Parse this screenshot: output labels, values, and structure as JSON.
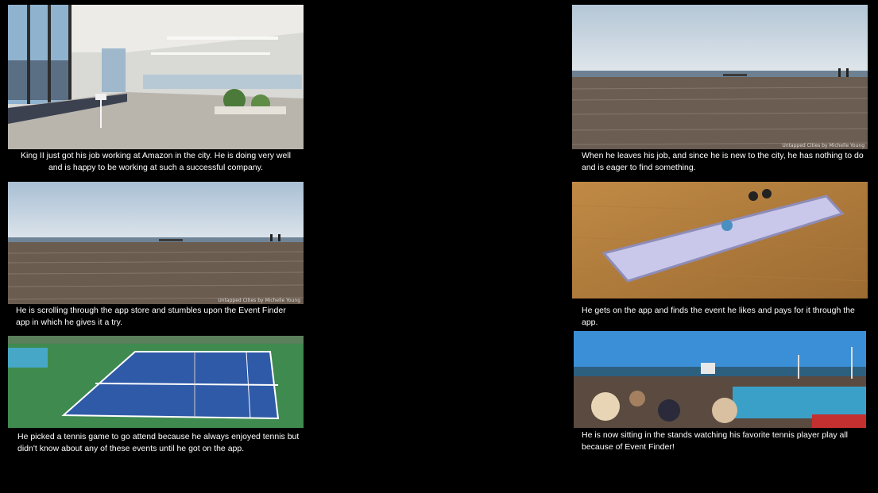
{
  "slides": [
    {
      "id": "office",
      "caption": "King II just got his job working at Amazon in the city. He is doing very well and is happy to be working at such a successful company."
    },
    {
      "id": "boardwalk-left",
      "caption": "He is scrolling through the app store and stumbles upon the Event Finder app in which he gives it a try.",
      "watermark": "Untapped Cities by Michelle Young"
    },
    {
      "id": "tennis-court",
      "caption": "He picked a tennis game to go attend because he always enjoyed tennis but didn't know about any of these events until he got on the app."
    },
    {
      "id": "boardwalk-right",
      "caption": "When he leaves his job, and since he is new to the city, he has nothing to do and is eager to find something.",
      "watermark": "Untapped Cities by Michelle Young"
    },
    {
      "id": "phone",
      "caption": "He gets on the app and finds the event he likes and pays for it through the app."
    },
    {
      "id": "stadium",
      "caption": "He is now sitting in the stands watching his favorite tennis player play all because of Event Finder!"
    }
  ]
}
